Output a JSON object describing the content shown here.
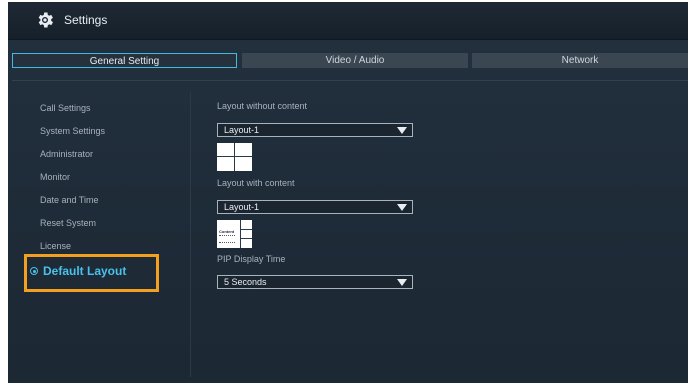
{
  "window": {
    "title": "Settings",
    "icon": "gear-icon"
  },
  "tabs": [
    {
      "label": "General Setting",
      "active": true
    },
    {
      "label": "Video / Audio",
      "active": false
    },
    {
      "label": "Network",
      "active": false
    }
  ],
  "sidebar": {
    "items": [
      {
        "label": "Call Settings"
      },
      {
        "label": "System Settings"
      },
      {
        "label": "Administrator"
      },
      {
        "label": "Monitor"
      },
      {
        "label": "Date and Time"
      },
      {
        "label": "Reset System"
      },
      {
        "label": "License"
      }
    ],
    "active_item": {
      "label": "Default Layout",
      "icon": "radio-selected-icon"
    }
  },
  "main": {
    "layout_without_content": {
      "label": "Layout without content",
      "value": "Layout-1"
    },
    "layout_with_content": {
      "label": "Layout with content",
      "value": "Layout-1",
      "thumb_text": "Content"
    },
    "pip_display_time": {
      "label": "PIP Display Time",
      "value": "5 Seconds"
    }
  },
  "colors": {
    "accent": "#49c1eb",
    "highlight_border": "#f2a01d",
    "background": "#1f2c39"
  }
}
